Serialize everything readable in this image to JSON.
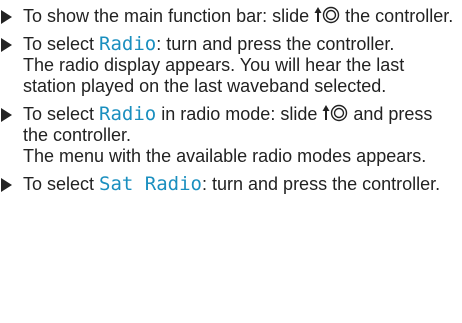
{
  "steps": [
    {
      "parts": [
        "To show the main function bar: slide ",
        " the controller."
      ]
    },
    {
      "before": "To select ",
      "term": "Radio",
      "after": ": turn and press the controller.",
      "result": "The radio display appears. You will hear the last station played on the last waveband selected."
    },
    {
      "before": "To select ",
      "term": "Radio",
      "middle": " in radio mode: slide ",
      "after": " and press the controller.",
      "result": "The menu with the available radio modes appears."
    },
    {
      "before": "To select ",
      "term": "Sat Radio",
      "after": ": turn and press the controller."
    }
  ],
  "colors": {
    "term": "#1a8fbf",
    "text": "#222222"
  },
  "icons": {
    "bullet": "triangle-bullet-icon",
    "controller": "controller-slide-up-icon"
  }
}
